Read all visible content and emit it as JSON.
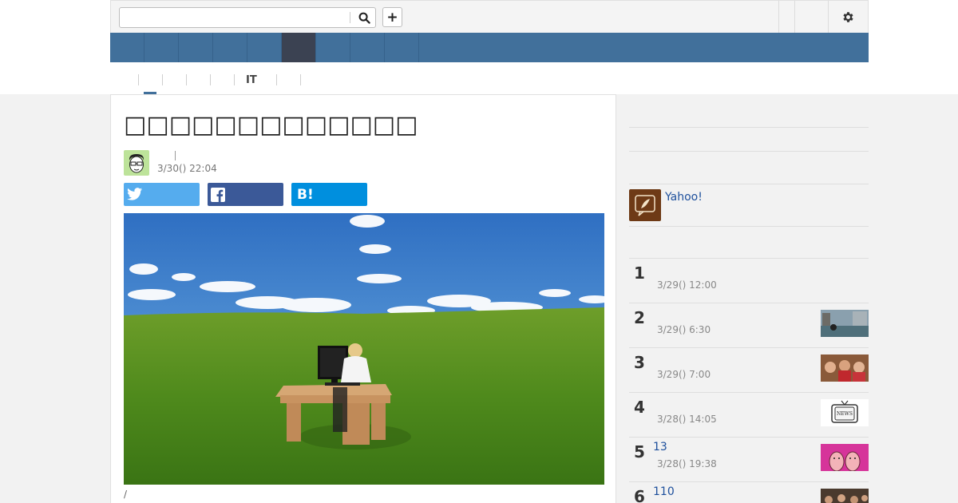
{
  "search": {
    "value": "",
    "placeholder": ""
  },
  "toolbar": {
    "add_label": "+"
  },
  "nav": {
    "items": [
      {
        "label": ""
      },
      {
        "label": ""
      },
      {
        "label": ""
      },
      {
        "label": ""
      },
      {
        "label": ""
      },
      {
        "label": ""
      },
      {
        "label": ""
      },
      {
        "label": ""
      },
      {
        "label": ""
      }
    ],
    "active_index": 5
  },
  "subtabs": [
    {
      "label": ""
    },
    {
      "label": ""
    },
    {
      "label": ""
    },
    {
      "label": ""
    },
    {
      "label": ""
    },
    {
      "label": "IT"
    },
    {
      "label": ""
    },
    {
      "label": ""
    }
  ],
  "article": {
    "title": "□□□□□□□□□□□□□",
    "author": "",
    "date": "3/30() 22:04",
    "caption": "/"
  },
  "share": {
    "twitter_label": "",
    "facebook_label": "",
    "hatena_label": "B!"
  },
  "sidebar": {
    "promo_text": "Yahoo!",
    "ranking": [
      {
        "rank": "1",
        "title": "",
        "date": "3/29() 12:00",
        "thumb": "none"
      },
      {
        "rank": "2",
        "title": "",
        "date": "3/29() 6:30",
        "thumb": "water-photo"
      },
      {
        "rank": "3",
        "title": "",
        "date": "3/29() 7:00",
        "thumb": "people-photo"
      },
      {
        "rank": "4",
        "title": "",
        "date": "3/28() 14:05",
        "thumb": "tv-news-icon"
      },
      {
        "rank": "5",
        "title": "13",
        "date": "3/28() 19:38",
        "thumb": "cartoon-illustration"
      },
      {
        "rank": "6",
        "title": "110",
        "date": "",
        "thumb": "crowd-photo"
      }
    ]
  },
  "colors": {
    "nav_blue": "#41709b",
    "nav_active": "#3b4252",
    "link_blue": "#1d4f9c",
    "twitter": "#55acee",
    "facebook": "#3b5998",
    "hatena": "#008fde"
  }
}
